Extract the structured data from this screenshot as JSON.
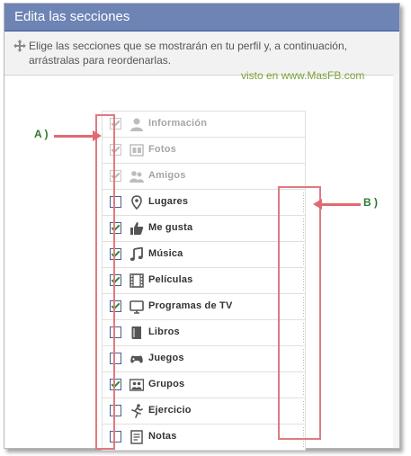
{
  "dialog": {
    "title": "Edita las secciones",
    "description": "Elige las secciones que se mostrarán en tu perfil y, a continuación, arrástralas para reordenarlas."
  },
  "watermark": "visto en www.MasFB.com",
  "callouts": {
    "a": "A )",
    "b": "B )"
  },
  "colors": {
    "title_bar": "#6d84b4",
    "check_green": "#2e8b2e",
    "annotation_red": "#e07a80",
    "watermark_green": "#7aa33a"
  },
  "sections": [
    {
      "label": "Información",
      "checked": true,
      "locked": true,
      "icon": "person-icon"
    },
    {
      "label": "Fotos",
      "checked": true,
      "locked": true,
      "icon": "photos-icon"
    },
    {
      "label": "Amigos",
      "checked": true,
      "locked": true,
      "icon": "friends-icon"
    },
    {
      "label": "Lugares",
      "checked": false,
      "locked": false,
      "icon": "map-pin-icon"
    },
    {
      "label": "Me gusta",
      "checked": true,
      "locked": false,
      "icon": "thumbs-up-icon"
    },
    {
      "label": "Música",
      "checked": true,
      "locked": false,
      "icon": "music-note-icon"
    },
    {
      "label": "Películas",
      "checked": true,
      "locked": false,
      "icon": "film-icon"
    },
    {
      "label": "Programas de TV",
      "checked": true,
      "locked": false,
      "icon": "tv-icon"
    },
    {
      "label": "Libros",
      "checked": false,
      "locked": false,
      "icon": "book-icon"
    },
    {
      "label": "Juegos",
      "checked": false,
      "locked": false,
      "icon": "gamepad-icon"
    },
    {
      "label": "Grupos",
      "checked": true,
      "locked": false,
      "icon": "group-icon"
    },
    {
      "label": "Ejercicio",
      "checked": false,
      "locked": false,
      "icon": "running-icon"
    },
    {
      "label": "Notas",
      "checked": false,
      "locked": false,
      "icon": "notes-icon"
    }
  ]
}
